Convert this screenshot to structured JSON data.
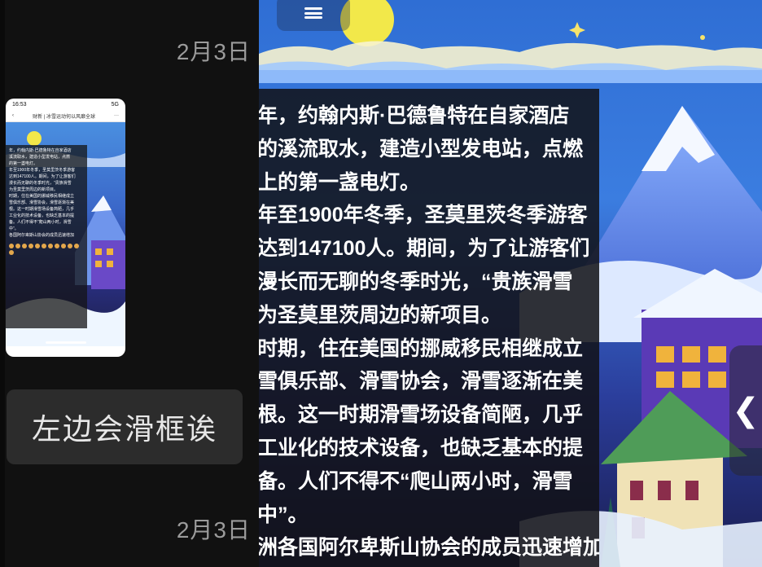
{
  "chat": {
    "date_top": "2月3日",
    "date_bottom": "2月3日",
    "message_text": "左边会滑框诶",
    "thumbnail": {
      "status_time": "16:53",
      "status_right": "5G",
      "nav_title": "财新 | 冰雪运动何以风靡全球",
      "preview_lines": [
        "年，约翰内斯·巴德鲁特在自家酒店",
        "溪流取水，建造小型发电站，点燃",
        "的第一盏电灯。",
        "年至1900年冬季，圣莫里茨冬季游客",
        "达到147100人。期间，为了让游客们",
        "漫长而无聊的冬季时光，“贵族滑雪",
        "为圣莫里茨周边的新项目。",
        "时期，住在美国的挪威移民相继成立",
        "雪俱乐部、滑雪协会，滑雪逐渐在美",
        "根。这一时期滑雪场设备简陋，几乎",
        "工业化的技术设备，也缺乏基本的提",
        "备。人们不得不“爬山两小时，滑雪",
        "中”。",
        "各国阿尔卑斯山协会的成员迅速增加"
      ]
    }
  },
  "viewer": {
    "menu_icon": "hamburger-icon",
    "handle_icon": "chevron-left-icon",
    "handle_glyph": "❮",
    "article_lines": [
      "年，约翰内斯·巴德鲁特在自家酒店",
      "的溪流取水，建造小型发电站，点燃",
      "上的第一盏电灯。",
      "年至1900年冬季，圣莫里茨冬季游客",
      "达到147100人。期间，为了让游客们",
      "漫长而无聊的冬季时光，“贵族滑雪",
      "为圣莫里茨周边的新项目。",
      "时期，住在美国的挪威移民相继成立",
      "雪俱乐部、滑雪协会，滑雪逐渐在美",
      "根。这一时期滑雪场设备简陋，几乎",
      "工业化的技术设备，也缺乏基本的提",
      "备。人们不得不“爬山两小时，滑雪",
      "中”。",
      "洲各国阿尔卑斯山协会的成员迅速增加"
    ]
  },
  "colors": {
    "sky_top": "#2f6ed4",
    "moon": "#f2e84a",
    "snow": "#e7f3ff",
    "mountain": "#5f84e6",
    "house_purple": "#5a3ab6",
    "window_yellow": "#f0b33c"
  }
}
